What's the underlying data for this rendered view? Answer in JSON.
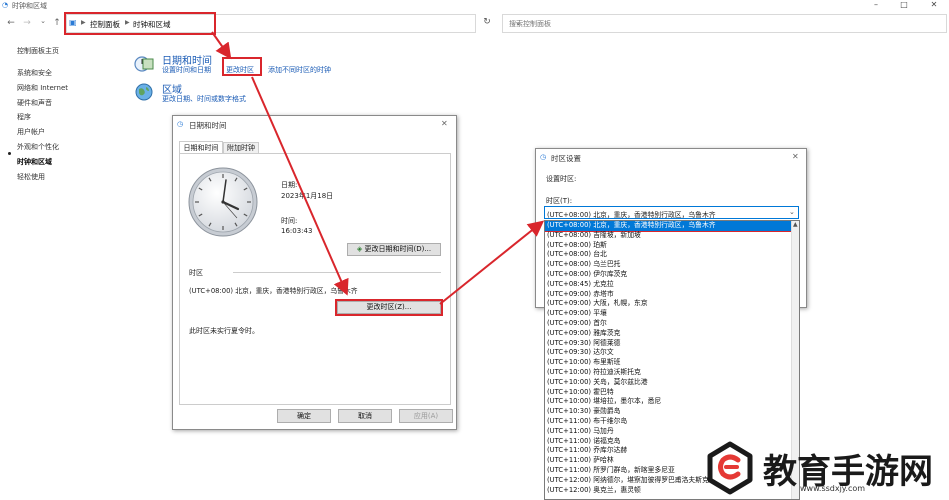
{
  "window": {
    "title": "时钟和区域",
    "minimize": "–",
    "maximize": "□",
    "close": "✕"
  },
  "nav": {
    "back": "←",
    "forward": "→",
    "recent": "⌄",
    "up": "↑",
    "refresh": "↻",
    "breadcrumb_root": "控制面板",
    "breadcrumb_sep": "▶",
    "breadcrumb_current": "时钟和区域",
    "search_placeholder": "搜索控制面板"
  },
  "sidebar": {
    "items": [
      {
        "label": "控制面板主页"
      },
      {
        "label": "系统和安全"
      },
      {
        "label": "网络和 Internet"
      },
      {
        "label": "硬件和声音"
      },
      {
        "label": "程序"
      },
      {
        "label": "用户帐户"
      },
      {
        "label": "外观和个性化"
      },
      {
        "label": "时钟和区域",
        "active": true
      },
      {
        "label": "轻松使用"
      }
    ]
  },
  "main": {
    "datetime": {
      "title": "日期和时间",
      "link1": "设置时间和日期",
      "link2": "更改时区",
      "link3": "添加不同时区的时钟"
    },
    "region": {
      "title": "区域",
      "link1": "更改日期、时间或数字格式"
    }
  },
  "datetime_dialog": {
    "title": "日期和时间",
    "tabs": [
      "日期和时间",
      "附加时钟"
    ],
    "date_label": "日期:",
    "date_value": "2023年1月18日",
    "time_label": "时间:",
    "time_value": "16:03:43",
    "change_datetime_button": "更改日期和时间(D)...",
    "timezone_header": "时区",
    "timezone_value": "(UTC+08:00) 北京，重庆，香港特别行政区，乌鲁木齐",
    "change_timezone_button": "更改时区(Z)...",
    "dst_note": "此时区未实行夏令时。",
    "ok": "确定",
    "cancel": "取消",
    "apply": "应用(A)"
  },
  "timezone_dialog": {
    "title": "时区设置",
    "set_label": "设置时区:",
    "tz_label": "时区(T):",
    "selected": "(UTC+08:00) 北京，重庆，香港特别行政区，乌鲁木齐",
    "options": [
      "(UTC+08:00) 北京，重庆，香港特别行政区，乌鲁木齐",
      "(UTC+08:00) 吉隆坡，新加坡",
      "(UTC+08:00) 珀斯",
      "(UTC+08:00) 台北",
      "(UTC+08:00) 乌兰巴托",
      "(UTC+08:00) 伊尔库茨克",
      "(UTC+08:45) 尤克拉",
      "(UTC+09:00) 赤塔市",
      "(UTC+09:00) 大阪，札幌，东京",
      "(UTC+09:00) 平壤",
      "(UTC+09:00) 首尔",
      "(UTC+09:00) 雅库茨克",
      "(UTC+09:30) 阿德莱德",
      "(UTC+09:30) 达尔文",
      "(UTC+10:00) 布里斯班",
      "(UTC+10:00) 符拉迪沃斯托克",
      "(UTC+10:00) 关岛，莫尔兹比港",
      "(UTC+10:00) 霍巴特",
      "(UTC+10:00) 堪培拉，墨尔本，悉尼",
      "(UTC+10:30) 豪勋爵岛",
      "(UTC+11:00) 布干维尔岛",
      "(UTC+11:00) 马加丹",
      "(UTC+11:00) 诺福克岛",
      "(UTC+11:00) 乔库尔达赫",
      "(UTC+11:00) 萨哈林",
      "(UTC+11:00) 所罗门群岛，新喀里多尼亚",
      "(UTC+12:00) 阿纳德尔，堪察加彼得罗巴甫洛夫斯克",
      "(UTC+12:00) 奥克兰，惠灵顿"
    ]
  },
  "watermark": {
    "brand": "教育手游网",
    "url": "www.ssdxjy.com"
  },
  "colors": {
    "accent": "#1a5bb5",
    "highlight": "#d9262c",
    "selection": "#0078d7"
  }
}
